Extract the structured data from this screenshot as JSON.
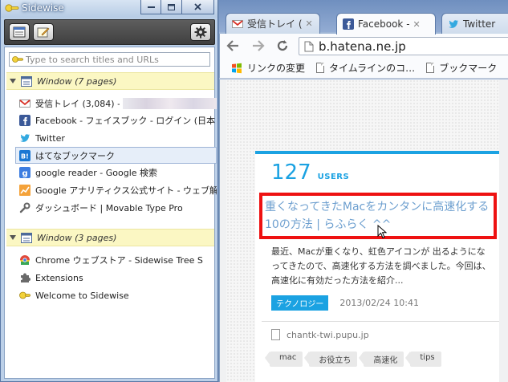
{
  "sidewise": {
    "title": "Sidewise",
    "search_placeholder": "Type to search titles and URLs",
    "windows": [
      {
        "label": "Window (7 pages)",
        "tabs": [
          {
            "title": "受信トレイ (3,084) -",
            "icon": "gmail-icon",
            "selected": false
          },
          {
            "title": "Facebook - フェイスブック - ログイン (日本",
            "icon": "facebook-icon",
            "selected": false
          },
          {
            "title": "Twitter",
            "icon": "twitter-icon",
            "selected": false
          },
          {
            "title": "はてなブックマーク",
            "icon": "hatena-icon",
            "selected": true
          },
          {
            "title": "google reader - Google 検索",
            "icon": "google-icon",
            "selected": false
          },
          {
            "title": "Google アナリティクス公式サイト - ウェブ解",
            "icon": "analytics-icon",
            "selected": false
          },
          {
            "title": "ダッシュボード | Movable Type Pro",
            "icon": "wrench-icon",
            "selected": false
          }
        ]
      },
      {
        "label": "Window (3 pages)",
        "tabs": [
          {
            "title": "Chrome ウェブストア - Sidewise Tree S",
            "icon": "chrome-store-icon",
            "selected": false
          },
          {
            "title": "Extensions",
            "icon": "puzzle-icon",
            "selected": false
          },
          {
            "title": "Welcome to Sidewise",
            "icon": "sidewise-icon",
            "selected": false
          }
        ]
      }
    ]
  },
  "chrome": {
    "tabs": [
      {
        "title": "受信トレイ (",
        "icon": "gmail-icon",
        "active": false
      },
      {
        "title": "Facebook - ",
        "icon": "facebook-icon",
        "active": true
      },
      {
        "title": "Twitter",
        "icon": "twitter-icon",
        "active": false
      }
    ],
    "url": "b.hatena.ne.jp",
    "bookmarks": [
      {
        "label": "リンクの変更",
        "icon": "windows-icon"
      },
      {
        "label": "タイムラインのコ…",
        "icon": "page-icon"
      },
      {
        "label": "ブックマーク",
        "icon": "page-icon"
      }
    ]
  },
  "entry": {
    "users_count": "127",
    "users_label": "USERS",
    "title": "重くなってきたMacをカンタンに高速化する10の方法 | らふらく ^^",
    "description": "最近、Macが重くなり、虹色アイコンが 出るようになってきたので、高速化する方法を調べました。今回は、高速化に有効だった方法を紹介...",
    "category": "テクノロジー",
    "date": "2013/02/24 10:41",
    "source": "chantk-twi.pupu.jp",
    "tags": [
      "mac",
      "お役立ち",
      "高速化",
      "tips"
    ]
  },
  "colors": {
    "accent": "#1ba2e2",
    "highlight_border": "#ee1111",
    "window_row_bg": "#fbf7c3"
  }
}
